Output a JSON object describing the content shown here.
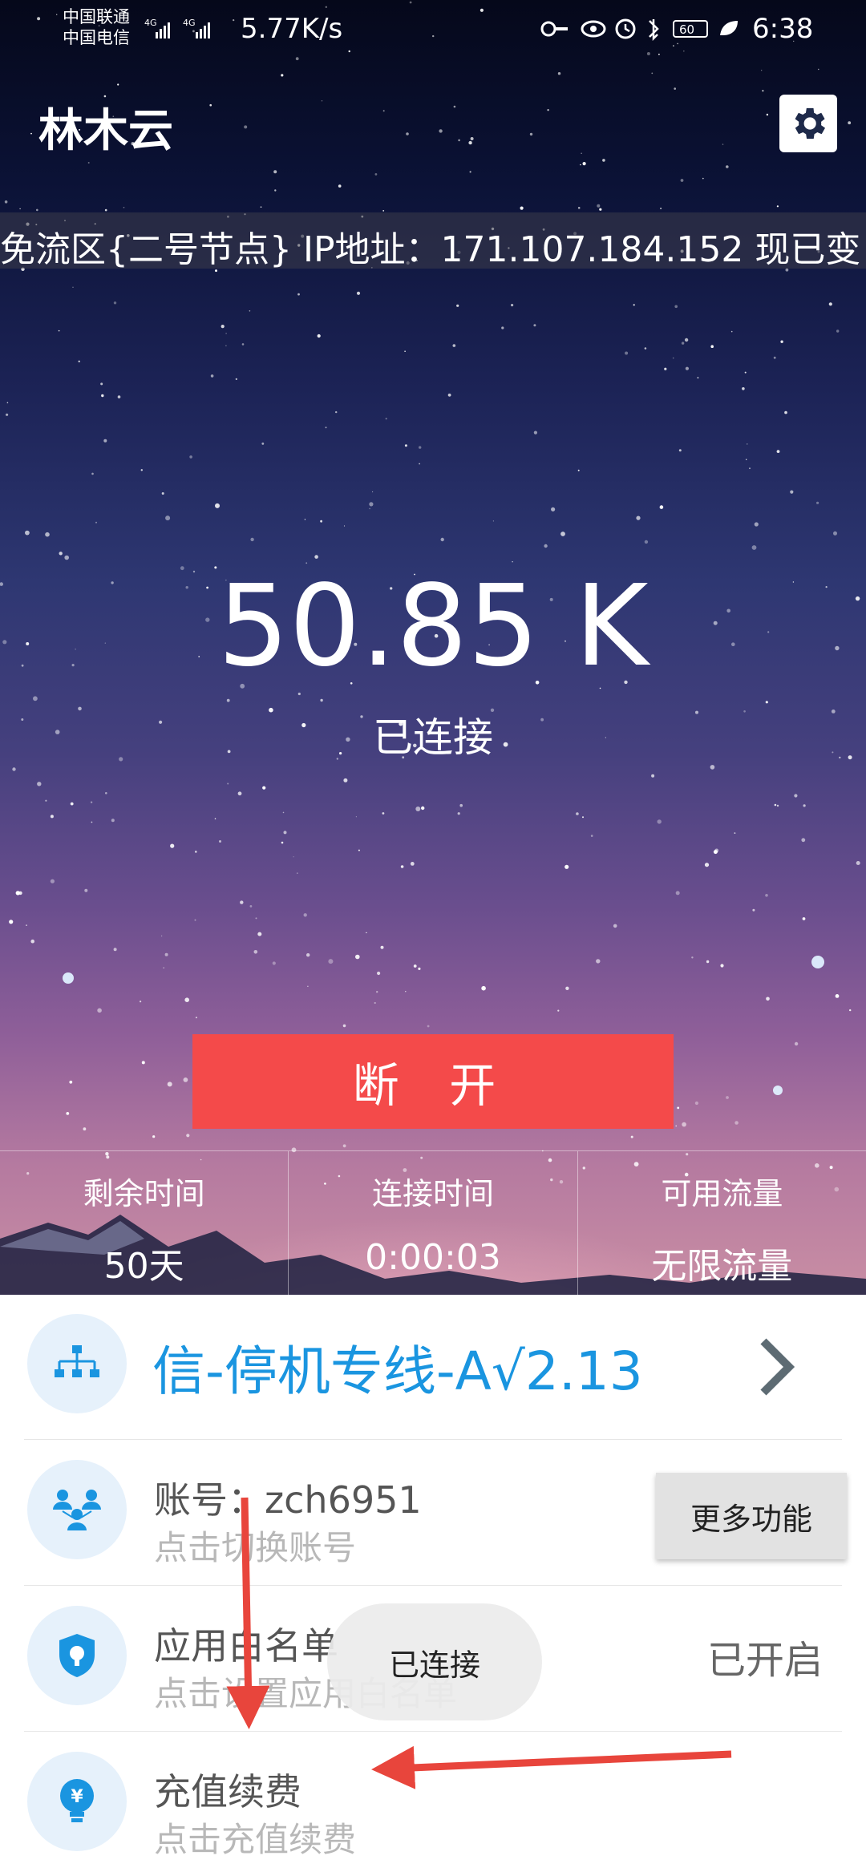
{
  "status_bar": {
    "carrier_1": "中国联通",
    "carrier_2": "中国电信",
    "net_speed": "5.77K/s",
    "battery": "60",
    "time": "6:38"
  },
  "header": {
    "title": "林木云",
    "settings_icon": "gear-icon"
  },
  "marquee": {
    "text": "免流区{二号节点} IP地址：171.107.184.152 现已变"
  },
  "speed": {
    "value": "50.85 K",
    "state": "已连接"
  },
  "disconnect_label": "断 开",
  "stats": [
    {
      "label": "剩余时间",
      "value": "50天"
    },
    {
      "label": "连接时间",
      "value": "0:00:03"
    },
    {
      "label": "可用流量",
      "value": "无限流量"
    }
  ],
  "list": {
    "route": {
      "text": "信-停机专线-A√2.13",
      "icon": "network-icon"
    },
    "account": {
      "title": "账号：zch6951",
      "subtitle": "点击切换账号",
      "button": "更多功能",
      "icon": "users-icon"
    },
    "whitelist": {
      "title": "应用白名单",
      "subtitle": "点击设置应用白名单",
      "status": "已开启",
      "icon": "shield-icon"
    },
    "recharge": {
      "title": "充值续费",
      "subtitle": "点击充值续费",
      "icon": "lightbulb-yen-icon"
    }
  },
  "toast": "已连接",
  "colors": {
    "accent_blue": "#1a95e0",
    "disconnect_red": "#f44a4a",
    "annotation_red": "#e8453c"
  }
}
